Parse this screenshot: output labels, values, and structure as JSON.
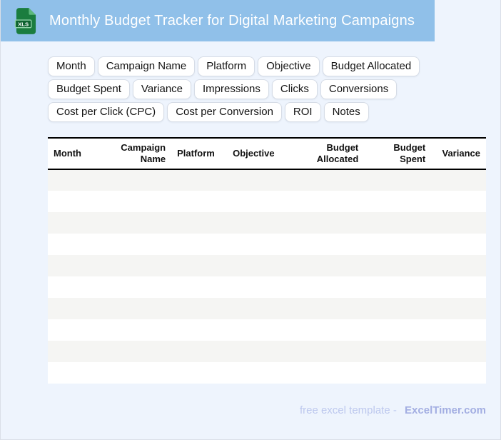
{
  "header": {
    "title": "Monthly Budget Tracker for Digital Marketing Campaigns",
    "file_badge": "XLS"
  },
  "field_chips": [
    "Month",
    "Campaign Name",
    "Platform",
    "Objective",
    "Budget Allocated",
    "Budget Spent",
    "Variance",
    "Impressions",
    "Clicks",
    "Conversions",
    "Cost per Click (CPC)",
    "Cost per Conversion",
    "ROI",
    "Notes"
  ],
  "table": {
    "columns": [
      {
        "label": "Month",
        "align": "left",
        "width": "12.0%"
      },
      {
        "label": "Campaign Name",
        "align": "right",
        "width": "16.2%"
      },
      {
        "label": "Platform",
        "align": "left",
        "width": "12.7%"
      },
      {
        "label": "Objective",
        "align": "left",
        "width": "13.0%"
      },
      {
        "label": "Budget Allocated",
        "align": "right",
        "width": "18.3%"
      },
      {
        "label": "Budget Spent",
        "align": "right",
        "width": "15.3%"
      },
      {
        "label": "Variance",
        "align": "right",
        "width": "12.5%"
      }
    ],
    "empty_row_count": 10
  },
  "footer": {
    "tagline": "free excel template -",
    "brand": "ExcelTimer.com"
  },
  "colors": {
    "header_bg": "#90c0e9",
    "page_bg": "#eef4fd",
    "row_stripe": "#f5f5f3",
    "chip_border": "#d6dce6",
    "icon_green": "#1b7d3f",
    "icon_green_dark": "#0e6330",
    "icon_green_fold": "#5cb87c",
    "footer_text": "#bdc8ee",
    "footer_brand": "#a3aee2"
  }
}
